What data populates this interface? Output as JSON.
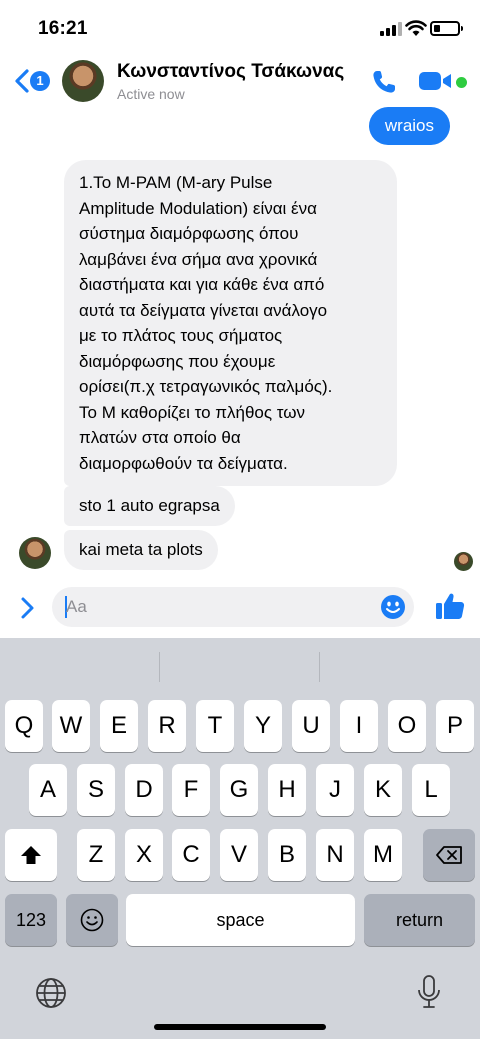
{
  "status_bar": {
    "time": "16:21",
    "battery_level": 0.25
  },
  "header": {
    "back_badge": "1",
    "contact_name": "Κωνσταντίνος Τσάκωνας",
    "contact_status": "Active now",
    "icons": [
      "chevron-left-icon",
      "phone-icon",
      "video-camera-icon"
    ],
    "accent_color": "#1a7cf5",
    "online_color": "#2ecc40"
  },
  "messages": [
    {
      "direction": "outgoing",
      "text": "wraios"
    },
    {
      "direction": "incoming",
      "text": "1.Το M-PAM (M-ary Pulse\nAmplitude Modulation) είναι ένα\nσύστημα διαμόρφωσης όπου\nλαμβάνει ένα σήμα ανα χρονικά\nδιαστήματα και για κάθε ένα από\nαυτά τα δείγματα γίνεται ανάλογο\nμε το πλάτος τους σήματος\nδιαμόρφωσης που έχουμε\nορίσει(π.χ τετραγωνικός παλμός).\nΤο Μ καθορίζει το πλήθος των\nπλατών στα οποίο θα\nδιαμορφωθούν τα δείγματα."
    },
    {
      "direction": "incoming",
      "text": "sto 1 auto egrapsa"
    },
    {
      "direction": "incoming",
      "text": "kai meta ta plots"
    }
  ],
  "composer": {
    "value": "",
    "placeholder": "Aa"
  },
  "keyboard": {
    "row1": [
      "Q",
      "W",
      "E",
      "R",
      "T",
      "Y",
      "U",
      "I",
      "O",
      "P"
    ],
    "row2": [
      "A",
      "S",
      "D",
      "F",
      "G",
      "H",
      "J",
      "K",
      "L"
    ],
    "row3": [
      "Z",
      "X",
      "C",
      "V",
      "B",
      "N",
      "M"
    ],
    "numbers_label": "123",
    "space_label": "space",
    "return_label": "return"
  }
}
